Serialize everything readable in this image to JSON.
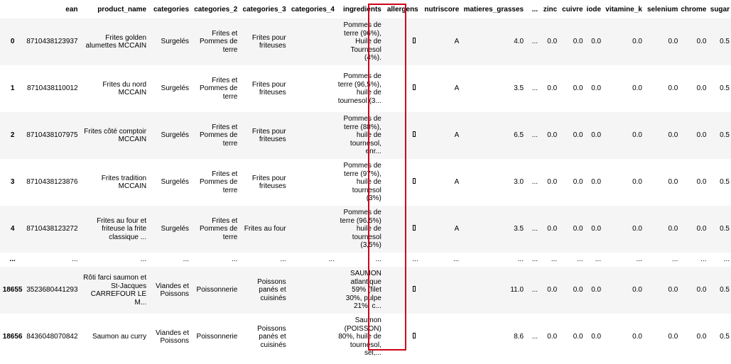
{
  "columns": [
    "",
    "ean",
    "product_name",
    "categories",
    "categories_2",
    "categories_3",
    "categories_4",
    "ingredients",
    "allergens",
    "nutriscore",
    "matieres_grasses",
    "...",
    "zinc",
    "cuivre",
    "iode",
    "vitamine_k",
    "selenium",
    "chrome",
    "sugar"
  ],
  "rows": [
    {
      "cells": [
        "0",
        "8710438123937",
        "Frites golden alumettes MCCAIN",
        "Surgelés",
        "Frites et Pommes de terre",
        "Frites pour friteuses",
        "",
        "Pommes de terre (96%), Huile de Tournesol (4%).",
        "[]",
        "A",
        "4.0",
        "...",
        "0.0",
        "0.0",
        "0.0",
        "0.0",
        "0.0",
        "0.0",
        "0.5"
      ]
    },
    {
      "cells": [
        "1",
        "8710438110012",
        "Frites du nord MCCAIN",
        "Surgelés",
        "Frites et Pommes de terre",
        "Frites pour friteuses",
        "",
        "Pommes de terre (96,5%), huile de tournesol (3...",
        "[]",
        "A",
        "3.5",
        "...",
        "0.0",
        "0.0",
        "0.0",
        "0.0",
        "0.0",
        "0.0",
        "0.5"
      ]
    },
    {
      "cells": [
        "2",
        "8710438107975",
        "Frites côté comptoir MCCAIN",
        "Surgelés",
        "Frites et Pommes de terre",
        "Frites pour friteuses",
        "",
        "Pommes de terre (88%), huile de tournesol, enr...",
        "[]",
        "A",
        "6.5",
        "...",
        "0.0",
        "0.0",
        "0.0",
        "0.0",
        "0.0",
        "0.0",
        "0.5"
      ]
    },
    {
      "cells": [
        "3",
        "8710438123876",
        "Frites tradition MCCAIN",
        "Surgelés",
        "Frites et Pommes de terre",
        "Frites pour friteuses",
        "",
        "Pommes de terre (97%), huile de tournesol (3%)",
        "[]",
        "A",
        "3.0",
        "...",
        "0.0",
        "0.0",
        "0.0",
        "0.0",
        "0.0",
        "0.0",
        "0.5"
      ]
    },
    {
      "cells": [
        "4",
        "8710438123272",
        "Frites au four et friteuse la frite classique ...",
        "Surgelés",
        "Frites et Pommes de terre",
        "Frites au four",
        "",
        "Pommes de terre (96.5%) huile de tournesol (3,5%)",
        "[]",
        "A",
        "3.5",
        "...",
        "0.0",
        "0.0",
        "0.0",
        "0.0",
        "0.0",
        "0.0",
        "0.5"
      ]
    },
    {
      "ellipsis": true,
      "cells": [
        "...",
        "...",
        "...",
        "...",
        "...",
        "...",
        "...",
        "...",
        "...",
        "...",
        "...",
        "...",
        "...",
        "...",
        "...",
        "...",
        "...",
        "...",
        "..."
      ]
    },
    {
      "cells": [
        "18655",
        "3523680441293",
        "Rôti farci saumon et St-Jacques CARREFOUR LE M...",
        "Viandes et Poissons",
        "Poissonnerie",
        "Poissons panés et cuisinés",
        "",
        "SAUMON atlantique 59% (filet 30%, pulpe 21%, c...",
        "[]",
        "",
        "11.0",
        "...",
        "0.0",
        "0.0",
        "0.0",
        "0.0",
        "0.0",
        "0.0",
        "0.5"
      ]
    },
    {
      "cells": [
        "18656",
        "8436048070842",
        "Saumon au curry",
        "Viandes et Poissons",
        "Poissonnerie",
        "Poissons panés et cuisinés",
        "",
        "Saumon (POISSON) 80%, huile de tournesol, sel,...",
        "[]",
        "",
        "8.6",
        "...",
        "0.0",
        "0.0",
        "0.0",
        "0.0",
        "0.0",
        "0.0",
        "0.5"
      ]
    }
  ],
  "highlight": {
    "column": "allergens",
    "color": "#d0021b"
  }
}
